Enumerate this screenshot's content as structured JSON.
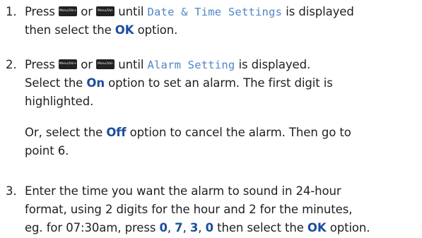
{
  "keys": {
    "menu_vol_plus": "Menu/Vol+",
    "menu_vol_minus": "Menu/Vol-"
  },
  "step1": {
    "number": "1.",
    "press": "Press",
    "or": "or",
    "until": "until",
    "lcd_text": "Date & Time Settings",
    "tail1": "is displayed",
    "line2_pre": "then select the",
    "ok": "OK",
    "line2_post": "option."
  },
  "step2": {
    "number": "2.",
    "press": "Press",
    "or": "or",
    "until": "until",
    "lcd_text": "Alarm Setting",
    "tail1": "is displayed.",
    "select_pre": "Select the",
    "on": "On",
    "select_post": "option to set an alarm. The first digit is",
    "line3": "highlighted.",
    "or_select_pre": "Or, select the",
    "off": "Off",
    "or_select_post": "option to cancel the alarm. Then go to",
    "line5": "point 6."
  },
  "step3": {
    "number": "3.",
    "line1": "Enter the time you want the alarm to sound in 24-hour",
    "line2": "format, using 2 digits for the hour and 2 for the minutes,",
    "line3_pre": "eg. for 07:30am, press",
    "d0": "0",
    "d7": "7",
    "d3": "3",
    "d0b": "0",
    "comma": ",",
    "then_select": "then select the",
    "ok": "OK",
    "option": "option."
  }
}
